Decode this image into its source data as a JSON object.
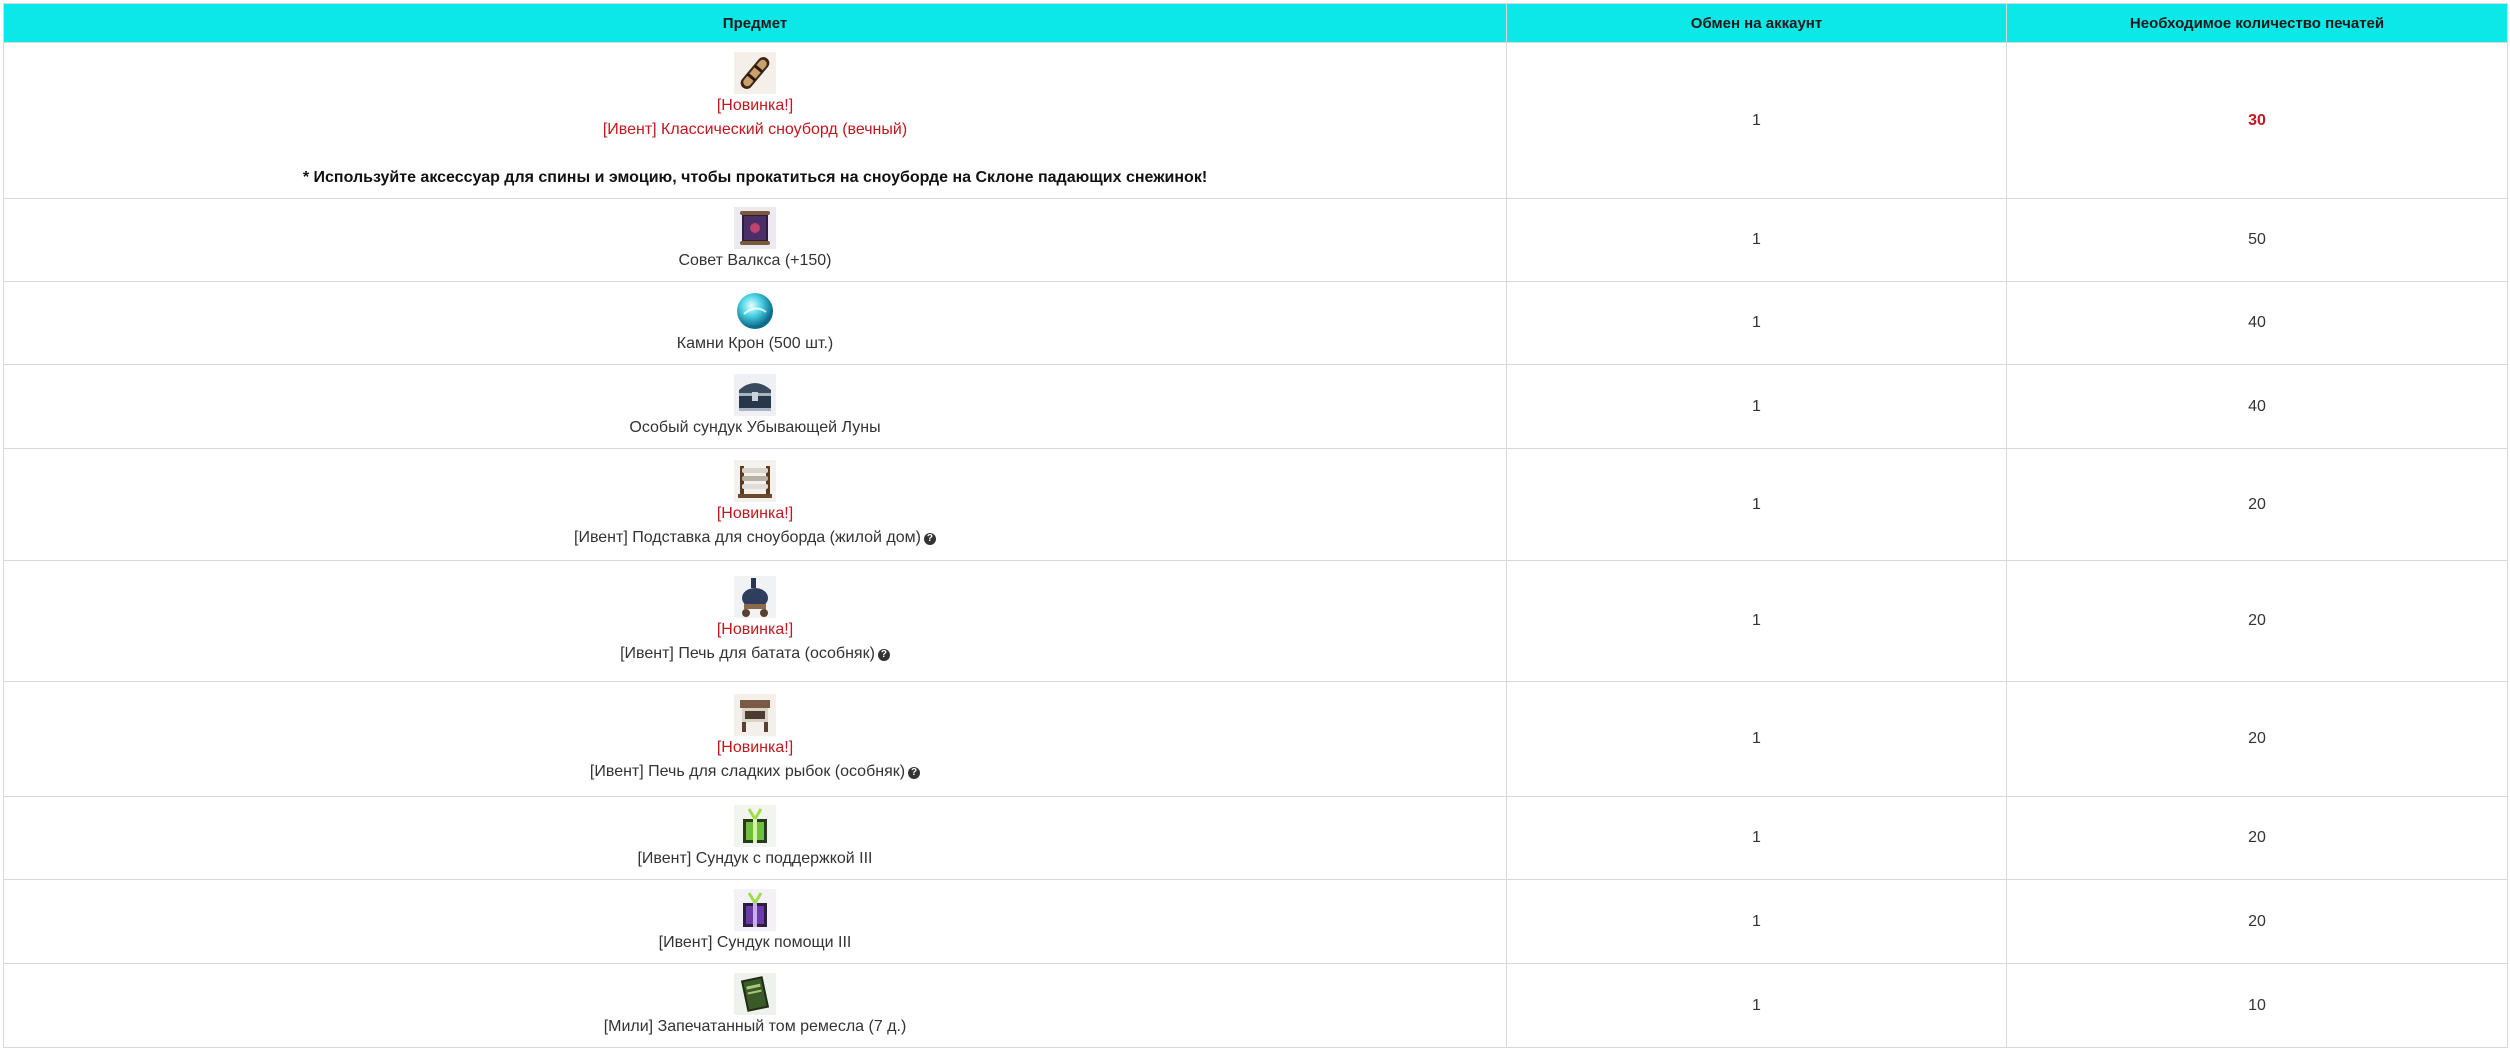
{
  "table": {
    "headers": {
      "item": "Предмет",
      "account_exchange": "Обмен на аккаунт",
      "seals_required": "Необходимое количество печатей"
    },
    "rows": [
      {
        "icon": "snowboard-icon",
        "new_label": "[Новинка!]",
        "name": "[Ивент] Классический сноуборд (вечный)",
        "note": "* Используйте аксессуар для спины и эмоцию, чтобы прокатиться на сноуборде на Склоне падающих снежинок!",
        "account": "1",
        "seals": "30"
      },
      {
        "icon": "scroll-icon",
        "name": "Совет Валкса (+150)",
        "account": "1",
        "seals": "50"
      },
      {
        "icon": "crystal-orb-icon",
        "name": "Камни Крон (500 шт.)",
        "account": "1",
        "seals": "40"
      },
      {
        "icon": "chest-icon",
        "name": "Особый сундук Убывающей Луны",
        "account": "1",
        "seals": "40"
      },
      {
        "icon": "snowboard-stand-icon",
        "new_label": "[Новинка!]",
        "name": "[Ивент] Подставка для сноуборда (жилой дом)",
        "help": "?",
        "account": "1",
        "seals": "20"
      },
      {
        "icon": "stove-icon",
        "new_label": "[Новинка!]",
        "name": "[Ивент] Печь для батата (особняк)",
        "help": "?",
        "account": "1",
        "seals": "20"
      },
      {
        "icon": "fish-oven-icon",
        "new_label": "[Новинка!]",
        "name": "[Ивент] Печь для сладких рыбок (особняк)",
        "help": "?",
        "account": "1",
        "seals": "20"
      },
      {
        "icon": "green-box-icon",
        "name": "[Ивент] Сундук с поддержкой III",
        "account": "1",
        "seals": "20"
      },
      {
        "icon": "purple-box-icon",
        "name": "[Ивент] Сундук помощи III",
        "account": "1",
        "seals": "20"
      },
      {
        "icon": "book-icon",
        "name": "[Мили] Запечатанный том ремесла (7 д.)",
        "account": "1",
        "seals": "10"
      }
    ]
  },
  "colors": {
    "header_bg": "#0ce8e8",
    "new_label": "#c4161c",
    "grid": "#d9d9d9"
  }
}
